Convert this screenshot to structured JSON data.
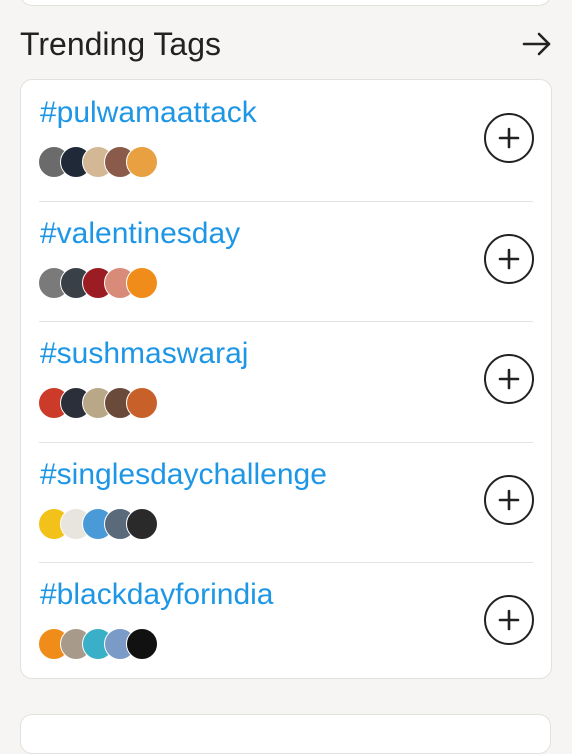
{
  "section": {
    "title": "Trending Tags",
    "arrow_icon": "arrow-right-icon"
  },
  "colors": {
    "tag_text": "#1e96e6",
    "title_text": "#222222",
    "page_bg": "#f6f5f3"
  },
  "tags": [
    {
      "name": "#pulwamaattack",
      "avatar_colors": [
        "#6b6b6b",
        "#1f2937",
        "#d4b896",
        "#8a5a4a",
        "#e8a040"
      ]
    },
    {
      "name": "#valentinesday",
      "avatar_colors": [
        "#7a7a7a",
        "#3a4048",
        "#9b1c22",
        "#d98b7a",
        "#f08c1a"
      ]
    },
    {
      "name": "#sushmaswaraj",
      "avatar_colors": [
        "#cc3a2a",
        "#2a2f3a",
        "#b8a888",
        "#6a4a3a",
        "#c8602a"
      ]
    },
    {
      "name": "#singlesdaychallenge",
      "avatar_colors": [
        "#f2c21a",
        "#e8e4de",
        "#4a9ad8",
        "#5a6a7a",
        "#2a2a2a"
      ]
    },
    {
      "name": "#blackdayforindia",
      "avatar_colors": [
        "#f08c1a",
        "#a89a8a",
        "#3ab0c8",
        "#7a9ac8",
        "#111111"
      ]
    }
  ]
}
